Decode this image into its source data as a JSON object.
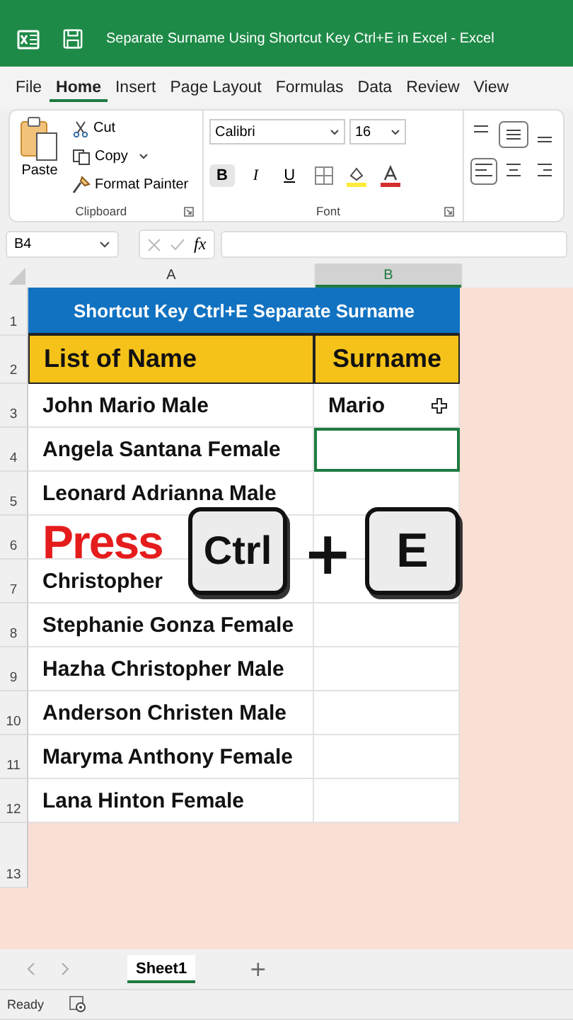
{
  "window": {
    "title": "Separate Surname Using Shortcut Key Ctrl+E in Excel  -  Excel"
  },
  "tabs": [
    {
      "label": "File",
      "selected": false
    },
    {
      "label": "Home",
      "selected": true
    },
    {
      "label": "Insert",
      "selected": false
    },
    {
      "label": "Page Layout",
      "selected": false
    },
    {
      "label": "Formulas",
      "selected": false
    },
    {
      "label": "Data",
      "selected": false
    },
    {
      "label": "Review",
      "selected": false
    },
    {
      "label": "View",
      "selected": false
    }
  ],
  "ribbon": {
    "clipboard": {
      "paste": "Paste",
      "cut": "Cut",
      "copy": "Copy",
      "format_painter": "Format Painter",
      "label": "Clipboard"
    },
    "font": {
      "font_name": "Calibri",
      "font_size": "16",
      "bold": "B",
      "italic": "I",
      "underline": "U",
      "label": "Font"
    }
  },
  "formula_bar": {
    "name_box": "B4",
    "fx": "fx"
  },
  "columns": [
    {
      "label": "A",
      "selected": false
    },
    {
      "label": "B",
      "selected": true
    }
  ],
  "title_row": {
    "num": "1",
    "text": "Shortcut Key Ctrl+E Separate Surname"
  },
  "header_row": {
    "num": "2",
    "name": "List of Name",
    "surname": "Surname"
  },
  "rows": [
    {
      "num": "3",
      "name": "John Mario Male",
      "surname": "Mario",
      "selected": false
    },
    {
      "num": "4",
      "name": "Angela Santana Female",
      "selected": true
    },
    {
      "num": "5",
      "name": "Leonard Adrianna Male",
      "selected": false
    },
    {
      "num": "6",
      "selected": false
    },
    {
      "num": "7",
      "name": "Christopher",
      "selected": false
    },
    {
      "num": "8",
      "name": "Stephanie Gonza Female",
      "selected": false
    },
    {
      "num": "9",
      "name": "Hazha Christopher Male",
      "selected": false
    },
    {
      "num": "10",
      "name": "Anderson Christen Male",
      "selected": false
    },
    {
      "num": "11",
      "name": "Maryma Anthony Female",
      "selected": false
    },
    {
      "num": "12",
      "name": "Lana Hinton Female",
      "selected": false
    }
  ],
  "empty_row": {
    "num": "13"
  },
  "overlay": {
    "press": "Press",
    "keys": [
      "Ctrl",
      "E"
    ],
    "plus": "+"
  },
  "sheet_tabs": [
    {
      "label": "Sheet1",
      "selected": true
    }
  ],
  "add_sheet": "+",
  "status_bar": {
    "text": "Ready"
  }
}
